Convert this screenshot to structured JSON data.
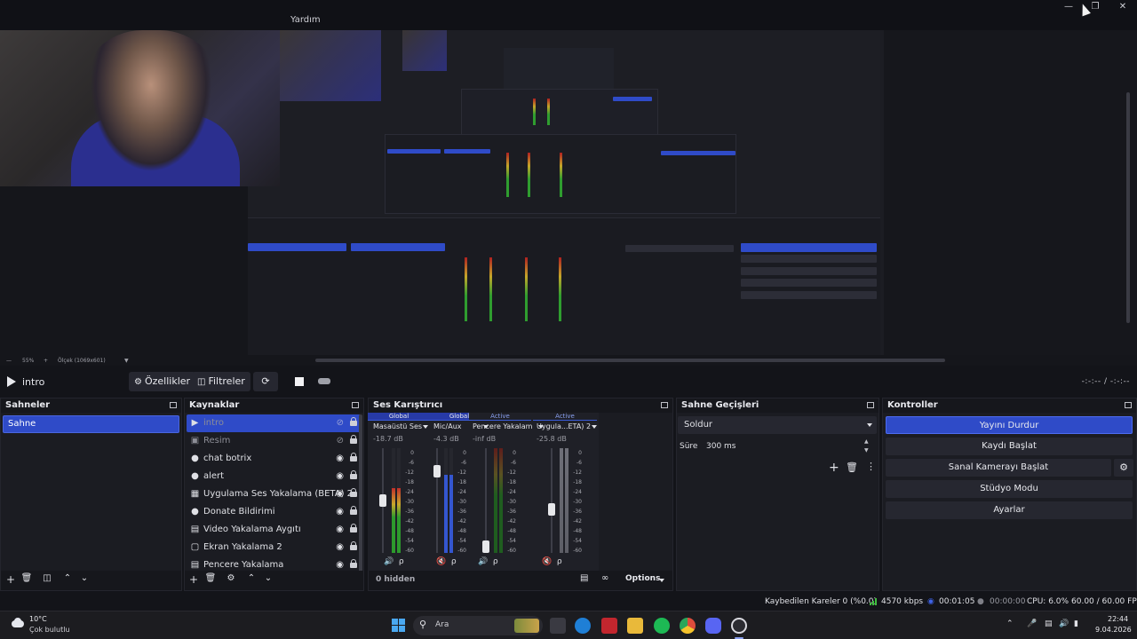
{
  "window": {
    "menu_item": "Yardım"
  },
  "toolbar": {
    "scene_name": "intro",
    "properties_label": "Özellikler",
    "filters_label": "Filtreler",
    "time_display": "-:-:-- / -:-:--"
  },
  "preview": {
    "zoom_label": "55%",
    "scale_label": "Ölçek (1069x601)"
  },
  "scenes": {
    "title": "Sahneler",
    "items": [
      "Sahne"
    ]
  },
  "sources": {
    "title": "Kaynaklar",
    "items": [
      {
        "label": "intro",
        "icon": "play-icon"
      },
      {
        "label": "Resim",
        "icon": "image-icon"
      },
      {
        "label": "chat botrix",
        "icon": "globe-icon"
      },
      {
        "label": "alert",
        "icon": "globe-icon"
      },
      {
        "label": "Uygulama Ses Yakalama (BETA) 2",
        "icon": "app-audio-icon"
      },
      {
        "label": "Donate Bildirimi",
        "icon": "globe-icon"
      },
      {
        "label": "Video Yakalama Aygıtı",
        "icon": "camera-icon"
      },
      {
        "label": "Ekran Yakalama 2",
        "icon": "monitor-icon"
      },
      {
        "label": "Pencere Yakalama",
        "icon": "window-icon"
      }
    ]
  },
  "mixer": {
    "title": "Ses Karıştırıcı",
    "channels": [
      {
        "tag": "Global",
        "name": "Masaüstü Ses",
        "db": "-18.7 dB",
        "level": 0.62
      },
      {
        "tag": "Global",
        "name": "Mic/Aux",
        "db": "-4.3 dB",
        "level": 0.75
      },
      {
        "tag": "Active",
        "name": "Pencere Yakalam",
        "db": "-inf dB",
        "level": 0.0
      },
      {
        "tag": "Active",
        "name": "Uygula...ETA) 2",
        "db": "-25.8 dB",
        "level": 0.45
      }
    ],
    "scale_ticks": [
      "0",
      "-6",
      "-12",
      "-18",
      "-24",
      "-30",
      "-36",
      "-42",
      "-48",
      "-54",
      "-60"
    ],
    "hidden_label": "0 hidden",
    "options_label": "Options"
  },
  "transitions": {
    "title": "Sahne Geçişleri",
    "selected": "Soldur",
    "duration_label": "Süre",
    "duration_value": "300 ms"
  },
  "controls": {
    "title": "Kontroller",
    "stop_stream": "Yayını Durdur",
    "start_recording": "Kaydı Başlat",
    "start_virtual_cam": "Sanal Kamerayı Başlat",
    "studio_mode": "Stüdyo Modu",
    "settings": "Ayarlar"
  },
  "status": {
    "dropped_frames": "Kaybedilen Kareler 0 (%0.0)",
    "bitrate": "4570 kbps",
    "stream_time": "00:01:05",
    "rec_time": "00:00:00",
    "cpu": "CPU: 6.0%",
    "fps": "60.00 / 60.00 FPS"
  },
  "taskbar": {
    "temperature": "10°C",
    "weather": "Çok bulutlu",
    "search_label": "Ara",
    "time": "22:44",
    "date": "9.04.2026"
  },
  "colors": {
    "accent": "#2f4bc8",
    "background": "#131419",
    "dock": "#1b1c22",
    "meter_green": "#2f9d2f",
    "meter_red": "#b02020"
  }
}
